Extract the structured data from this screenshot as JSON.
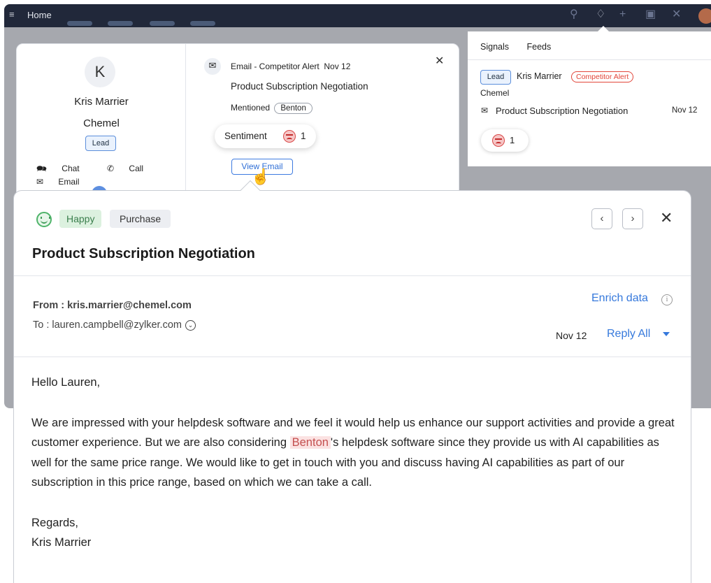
{
  "topbar": {
    "menu_icon": "hamburger-icon",
    "home_label": "Home",
    "icons": [
      "search-icon",
      "bell-icon",
      "plus-icon",
      "calendar-icon",
      "tools-icon",
      "user-avatar"
    ]
  },
  "contact": {
    "initial": "K",
    "name": "Kris Marrier",
    "company": "Chemel",
    "badge": "Lead",
    "actions": {
      "chat": "Chat",
      "call": "Call",
      "email": "Email"
    }
  },
  "email_summary": {
    "title": "Email - Competitor Alert",
    "date": "Nov 12",
    "subject": "Product Subscription Negotiation",
    "mentioned_label": "Mentioned",
    "mentioned_chip": "Benton",
    "view_email": "View Email"
  },
  "sentiment_popup": {
    "label": "Sentiment",
    "count": "1"
  },
  "signals_panel": {
    "tabs": [
      "Signals",
      "Feeds"
    ],
    "lead_badge": "Lead",
    "name": "Kris Marrier",
    "alert": "Competitor Alert",
    "company": "Chemel",
    "subject": "Product Subscription Negotiation",
    "date": "Nov 12",
    "sentiment_count": "1"
  },
  "email_view": {
    "happy_tag": "Happy",
    "purchase_tag": "Purchase",
    "subject": "Product Subscription Negotiation",
    "from": "From : kris.marrier@chemel.com",
    "to": "To : lauren.campbell@zylker.com",
    "enrich": "Enrich data",
    "date": "Nov 12",
    "reply_all": "Reply All",
    "greeting": "Hello Lauren,",
    "body_part1": "We are impressed with your helpdesk software and we feel it would help us enhance our support activities and provide a great customer experience. But we are also considering",
    "body_highlight": "Benton",
    "body_part2": "'s  helpdesk software since they provide us with AI capabilities as well for the same price range. We would like to get in touch with you and discuss having AI capabilities as part of our subscription in this price range, based on which we can take a call.",
    "regards": "Regards,",
    "signature": "Kris Marrier"
  },
  "colors": {
    "topbar": "#21283a",
    "link_blue": "#3679dc",
    "competitor_red": "#e2463a",
    "happy_green": "#4fb46a"
  }
}
